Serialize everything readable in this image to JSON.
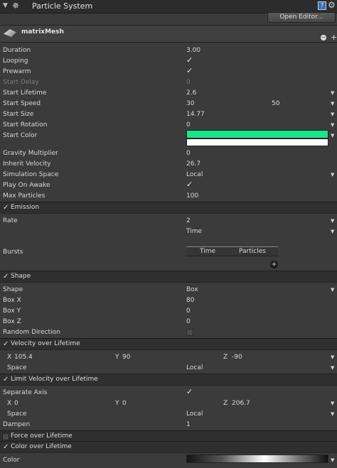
{
  "header": {
    "title": "Particle System",
    "open_editor": "Open Editor...",
    "mesh": "matrixMesh"
  },
  "main": [
    {
      "label": "Duration",
      "value": "3.00"
    },
    {
      "label": "Looping",
      "check": true
    },
    {
      "label": "Prewarm",
      "check": true
    },
    {
      "label": "Start Delay",
      "value": "0",
      "dim": true
    },
    {
      "label": "Start Lifetime",
      "value": "2.6",
      "arrow": true
    },
    {
      "label": "Start Speed",
      "value": "30",
      "value2": "50",
      "arrow": true
    },
    {
      "label": "Start Size",
      "value": "14.77",
      "arrow": true
    },
    {
      "label": "Start Rotation",
      "value": "0",
      "arrow": true
    },
    {
      "label": "Start Color",
      "arrow": true
    },
    {
      "label": "Gravity Multiplier",
      "value": "0"
    },
    {
      "label": "Inherit Velocity",
      "value": "26.7"
    },
    {
      "label": "Simulation Space",
      "value": "Local",
      "arrow": true
    },
    {
      "label": "Play On Awake",
      "check": true
    },
    {
      "label": "Max Particles",
      "value": "100"
    }
  ],
  "start_color": {
    "top": "#1be48a",
    "bottom": "#ffffff"
  },
  "modules": {
    "emission": "Emission",
    "shape": "Shape",
    "velocity": "Velocity over Lifetime",
    "limit": "Limit Velocity over Lifetime",
    "force": "Force over Lifetime",
    "color": "Color over Lifetime"
  },
  "emission": {
    "rate_label": "Rate",
    "rate_value": "2",
    "time": "Time",
    "bursts": "Bursts",
    "col_time": "Time",
    "col_particles": "Particles"
  },
  "shape": [
    {
      "label": "Shape",
      "value": "Box",
      "arrow": true
    },
    {
      "label": "Box X",
      "value": "80"
    },
    {
      "label": "Box Y",
      "value": "0"
    },
    {
      "label": "Box Z",
      "value": "0"
    },
    {
      "label": "Random Direction",
      "checkbox": true
    }
  ],
  "velocity": {
    "x": "105.4",
    "y": "90",
    "z": "-90",
    "space_label": "Space",
    "space": "Local"
  },
  "limit": {
    "separate": "Separate Axis",
    "x": "0",
    "y": "0",
    "z": "206.7",
    "space_label": "Space",
    "space": "Local",
    "dampen_label": "Dampen",
    "dampen": "1"
  },
  "color": {
    "label": "Color"
  },
  "axis": {
    "x": "X",
    "y": "Y",
    "z": "Z"
  }
}
